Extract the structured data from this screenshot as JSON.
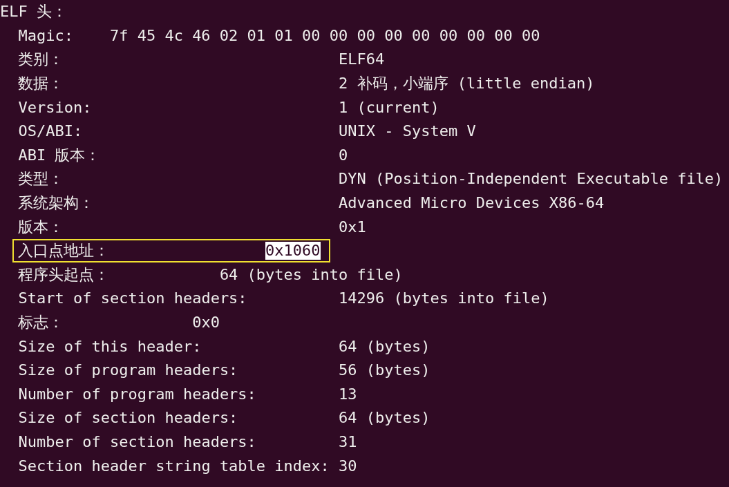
{
  "header": "ELF 头：",
  "rows": [
    {
      "kind": "magic",
      "label": "Magic:",
      "value": "7f 45 4c 46 02 01 01 00 00 00 00 00 00 00 00 00",
      "boxed": false,
      "selected": false
    },
    {
      "kind": "field",
      "label": "类别：",
      "value": "ELF64",
      "boxed": false,
      "selected": false
    },
    {
      "kind": "field",
      "label": "数据：",
      "value": "2 补码，小端序 (little endian)",
      "boxed": false,
      "selected": false
    },
    {
      "kind": "field",
      "label": "Version:",
      "value": "1 (current)",
      "boxed": false,
      "selected": false
    },
    {
      "kind": "field",
      "label": "OS/ABI:",
      "value": "UNIX - System V",
      "boxed": false,
      "selected": false
    },
    {
      "kind": "field",
      "label": "ABI 版本：",
      "value": "0",
      "boxed": false,
      "selected": false
    },
    {
      "kind": "field",
      "label": "类型：",
      "value": "DYN (Position-Independent Executable file)",
      "boxed": false,
      "selected": false
    },
    {
      "kind": "field",
      "label": "系统架构：",
      "value": "Advanced Micro Devices X86-64",
      "boxed": false,
      "selected": false
    },
    {
      "kind": "field",
      "label": "版本：",
      "value": "0x1",
      "boxed": false,
      "selected": false
    },
    {
      "kind": "entry",
      "label": "入口点地址：",
      "value": "0x1060",
      "boxed": true,
      "selected": true
    },
    {
      "kind": "offset",
      "label": "程序头起点：",
      "value": "64 (bytes into file)",
      "boxed": false,
      "selected": false
    },
    {
      "kind": "field",
      "label": "Start of section headers:",
      "value": "14296 (bytes into file)",
      "boxed": false,
      "selected": false
    },
    {
      "kind": "flags",
      "label": "标志：",
      "value": "0x0",
      "boxed": false,
      "selected": false
    },
    {
      "kind": "field",
      "label": "Size of this header:",
      "value": "64 (bytes)",
      "boxed": false,
      "selected": false
    },
    {
      "kind": "field",
      "label": "Size of program headers:",
      "value": "56 (bytes)",
      "boxed": false,
      "selected": false
    },
    {
      "kind": "field",
      "label": "Number of program headers:",
      "value": "13",
      "boxed": false,
      "selected": false
    },
    {
      "kind": "field",
      "label": "Size of section headers:",
      "value": "64 (bytes)",
      "boxed": false,
      "selected": false
    },
    {
      "kind": "field",
      "label": "Number of section headers:",
      "value": "31",
      "boxed": false,
      "selected": false
    },
    {
      "kind": "field",
      "label": "Section header string table index:",
      "value": "30",
      "boxed": false,
      "selected": false
    }
  ]
}
